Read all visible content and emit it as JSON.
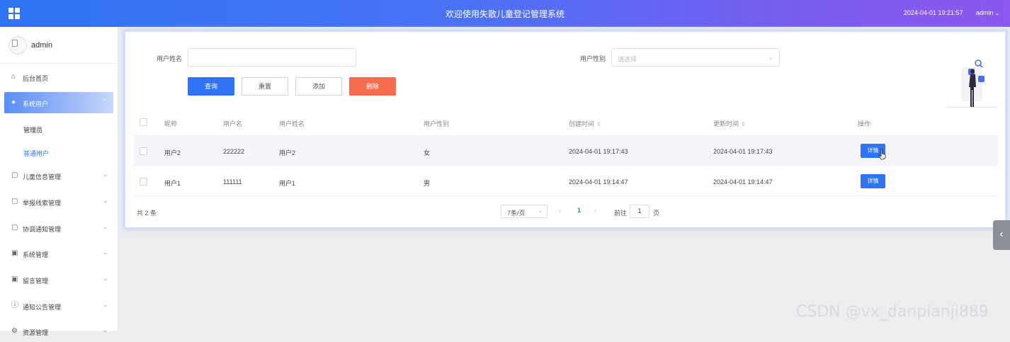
{
  "header": {
    "title": "欢迎使用失散儿童登记管理系统",
    "datetime": "2024-04-01 19:21:57",
    "user": "admin"
  },
  "sidebar": {
    "profile_name": "admin",
    "items": [
      {
        "label": "后台首页",
        "icon": "home-icon"
      },
      {
        "label": "系统用户",
        "icon": "user-icon",
        "active": true
      },
      {
        "label": "儿童信息管理",
        "icon": "document-icon"
      },
      {
        "label": "举报线索管理",
        "icon": "document-icon"
      },
      {
        "label": "协调通知管理",
        "icon": "document-icon"
      },
      {
        "label": "系统管理",
        "icon": "image-icon"
      },
      {
        "label": "留言管理",
        "icon": "image-icon"
      },
      {
        "label": "通知公告管理",
        "icon": "info-icon"
      },
      {
        "label": "资源管理",
        "icon": "gear-icon"
      }
    ],
    "subitems": [
      {
        "label": "管理员"
      },
      {
        "label": "普通用户",
        "current": true
      }
    ]
  },
  "search": {
    "name_label": "用户姓名",
    "name_value": "",
    "gender_label": "用户性别",
    "gender_placeholder": "请选择",
    "query_btn": "查询",
    "reset_btn": "重置",
    "add_btn": "添加",
    "delete_btn": "删除"
  },
  "table": {
    "columns": [
      "昵称",
      "用户名",
      "用户姓名",
      "用户性别",
      "创建时间",
      "更新时间",
      "操作"
    ],
    "rows": [
      {
        "nickname": "用户2",
        "username": "222222",
        "realname": "用户2",
        "gender": "女",
        "created": "2024-04-01 19:17:43",
        "updated": "2024-04-01 19:17:43",
        "action": "详情"
      },
      {
        "nickname": "用户1",
        "username": "111111",
        "realname": "用户1",
        "gender": "男",
        "created": "2024-04-01 19:14:47",
        "updated": "2024-04-01 19:14:47",
        "action": "详情"
      }
    ]
  },
  "pager": {
    "total": "共 2 条",
    "page_size": "7条/页",
    "current_page": "1",
    "goto_label": "前往",
    "goto_value": "1",
    "unit": "页"
  },
  "watermark": "CSDN @vx_danpianji889",
  "colors": {
    "primary": "#2f74f4",
    "danger": "#f56c4c",
    "header_end": "#8c58ef"
  }
}
